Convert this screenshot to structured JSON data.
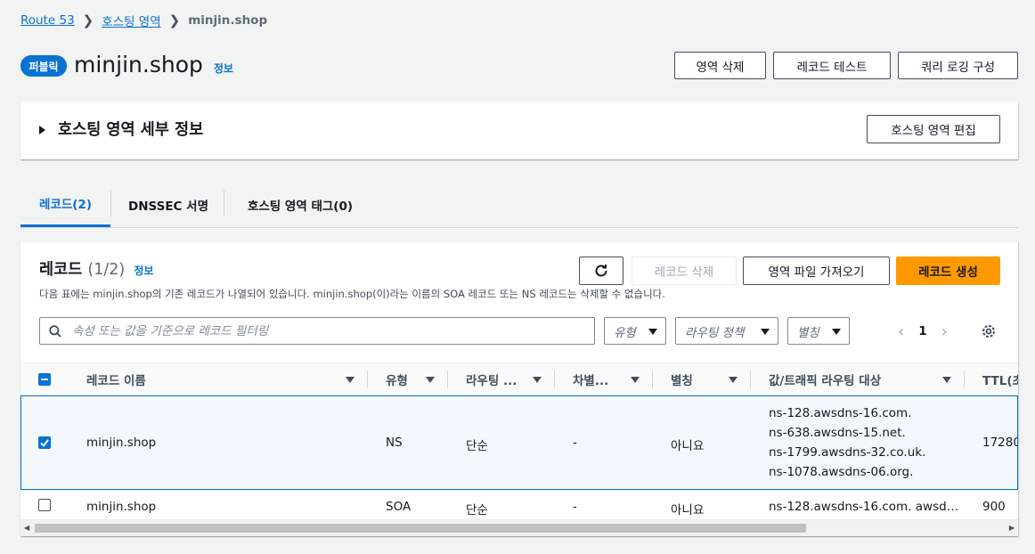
{
  "breadcrumb": [
    "Route 53",
    "호스팅 영역",
    "minjin.shop"
  ],
  "header": {
    "badge": "퍼블릭",
    "title": "minjin.shop",
    "info": "정보",
    "buttons": [
      "영역 삭제",
      "레코드 테스트",
      "쿼리 로깅 구성"
    ]
  },
  "details": {
    "title": "호스팅 영역 세부 정보",
    "edit_button": "호스팅 영역 편집"
  },
  "tabs": [
    {
      "label": "레코드(2)",
      "active": true
    },
    {
      "label": "DNSSEC 서명",
      "active": false
    },
    {
      "label": "호스팅 영역 태그(0)",
      "active": false
    }
  ],
  "records": {
    "title": "레코드",
    "count": "(1/2)",
    "info": "정보",
    "description": "다음 표에는 minjin.shop의 기존 레코드가 나열되어 있습니다. minjin.shop(이)라는 이름의 SOA 레코드 또는 NS 레코드는 삭제할 수 없습니다.",
    "buttons": {
      "delete": "레코드 삭제",
      "import": "영역 파일 가져오기",
      "create": "레코드 생성"
    },
    "search_placeholder": "속성 또는 값을 기준으로 레코드 필터링",
    "filters": [
      "유형",
      "라우팅 정책",
      "별칭"
    ],
    "page": "1",
    "columns": [
      "레코드 이름",
      "유형",
      "라우팅 ...",
      "차별...",
      "별칭",
      "값/트래픽 라우팅 대상",
      "TTL(초"
    ],
    "rows": [
      {
        "selected": true,
        "name": "minjin.shop",
        "type": "NS",
        "routing": "단순",
        "diff": "-",
        "alias": "아니요",
        "values": [
          "ns-128.awsdns-16.com.",
          "ns-638.awsdns-15.net.",
          "ns-1799.awsdns-32.co.uk.",
          "ns-1078.awsdns-06.org."
        ],
        "ttl": "17280"
      },
      {
        "selected": false,
        "name": "minjin.shop",
        "type": "SOA",
        "routing": "단순",
        "diff": "-",
        "alias": "아니요",
        "values": [
          "ns-128.awsdns-16.com. awsd…"
        ],
        "ttl": "900"
      }
    ]
  },
  "colors": {
    "accent": "#0972d3",
    "primary_button": "#ff9900",
    "background": "#f2f3f3"
  }
}
